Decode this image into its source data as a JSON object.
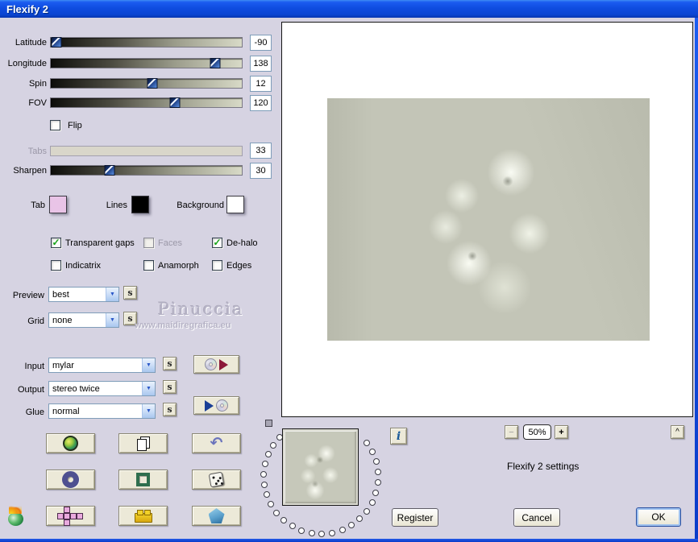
{
  "window": {
    "title": "Flexify 2"
  },
  "sliders": [
    {
      "label": "Latitude",
      "value": "-90",
      "percent": 3,
      "disabled": false
    },
    {
      "label": "Longitude",
      "value": "138",
      "percent": 86,
      "disabled": false
    },
    {
      "label": "Spin",
      "value": "12",
      "percent": 53,
      "disabled": false
    },
    {
      "label": "FOV",
      "value": "120",
      "percent": 65,
      "disabled": false
    },
    {
      "label": "Tabs",
      "value": "33",
      "percent": 0,
      "disabled": true
    },
    {
      "label": "Sharpen",
      "value": "30",
      "percent": 31,
      "disabled": false
    }
  ],
  "flip": {
    "label": "Flip",
    "checked": false,
    "mark": ""
  },
  "options_row1": [
    {
      "label": "Transparent gaps",
      "checked": true,
      "disabled": false,
      "mark": "✓"
    },
    {
      "label": "Faces",
      "checked": false,
      "disabled": true,
      "mark": ""
    },
    {
      "label": "De-halo",
      "checked": true,
      "disabled": false,
      "mark": "✓"
    }
  ],
  "options_row2": [
    {
      "label": "Indicatrix",
      "checked": false,
      "mark": ""
    },
    {
      "label": "Anamorph",
      "checked": false,
      "mark": ""
    },
    {
      "label": "Edges",
      "checked": false,
      "mark": ""
    }
  ],
  "swatches": [
    {
      "label": "Tab",
      "color": "#e9c4e7"
    },
    {
      "label": "Lines",
      "color": "#000000"
    },
    {
      "label": "Background",
      "color": "#ffffff"
    }
  ],
  "dropdowns": {
    "preview": {
      "label": "Preview",
      "value": "best"
    },
    "grid": {
      "label": "Grid",
      "value": "none"
    },
    "input": {
      "label": "Input",
      "value": "mylar"
    },
    "output": {
      "label": "Output",
      "value": "stereo twice"
    },
    "glue": {
      "label": "Glue",
      "value": "normal"
    }
  },
  "icons": {
    "chevron_down": "▼",
    "shuffle": "s",
    "undo": "↶",
    "info": "i",
    "minus": "−",
    "plus": "+",
    "caret": "^"
  },
  "watermark": {
    "line1": "Pinuccia",
    "line2": "www.maidiregrafica.eu"
  },
  "zoom": {
    "value": "50%"
  },
  "status_text": "Flexify 2 settings",
  "buttons": {
    "register": "Register",
    "cancel": "Cancel",
    "ok": "OK"
  },
  "colors": {
    "titlebar": "#0f4de0",
    "dialog_bg": "#d6d3e2",
    "button_face": "#ece9d8",
    "check_green": "#17a317",
    "thumb_blue": "#1e3f86"
  }
}
